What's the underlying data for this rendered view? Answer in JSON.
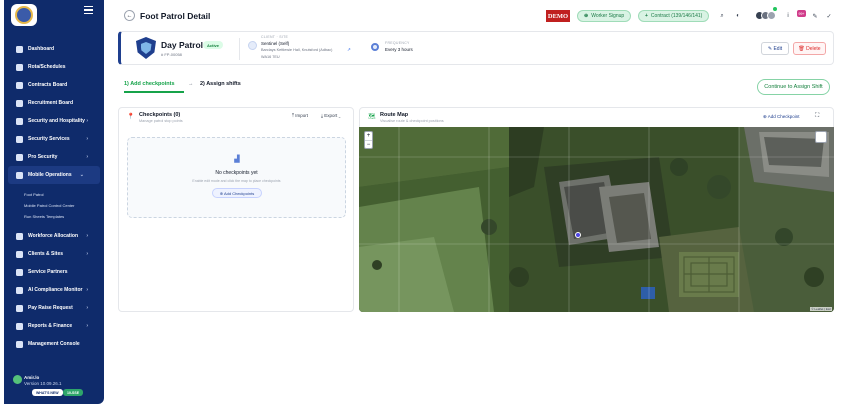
{
  "sidebar": {
    "items": [
      {
        "label": "Dashboard"
      },
      {
        "label": "Rota/Schedules"
      },
      {
        "label": "Contracts Board"
      },
      {
        "label": "Recruitment Board"
      },
      {
        "label": "Security and Hospitality",
        "chevron": "›"
      },
      {
        "label": "Security Services",
        "chevron": "›"
      },
      {
        "label": "Pro Security",
        "chevron": "›"
      },
      {
        "label": "Mobile Operations",
        "chevron": "⌄"
      }
    ],
    "sub_items": [
      {
        "label": "Foot Patrol"
      },
      {
        "label": "Mobile Patrol Control Center"
      },
      {
        "label": "Run Sheets Templates"
      }
    ],
    "items_after": [
      {
        "label": "Workforce Allocation",
        "chevron": "›"
      },
      {
        "label": "Clients & Sites",
        "chevron": "›"
      },
      {
        "label": "Service Partners"
      },
      {
        "label": "AI Compliance Monitor",
        "chevron": "›"
      },
      {
        "label": "Pay Raise Request",
        "chevron": "›"
      },
      {
        "label": "Reports & Finance",
        "chevron": "›"
      },
      {
        "label": "Management Console"
      }
    ],
    "user": {
      "name": "Amir.lo",
      "version": "Version 10.09.26.1"
    },
    "whats_new": "WHAT'S NEW",
    "env_badge": "10-SSE"
  },
  "topbar": {
    "title": "Foot Patrol Detail",
    "back_icon": "←",
    "demo_badge": "DEMO",
    "worker_signup": "Worker Signup",
    "worker_signup_icon": "⊕",
    "contract": "Contract (139/146/141)",
    "contract_icon": "+",
    "notification_count": "99+",
    "icons": {
      "search": "⌕",
      "theme": "◐",
      "info": "i",
      "edit": "✎",
      "check": "✓"
    }
  },
  "patrol": {
    "name": "Day Patrol",
    "status": "Active",
    "id": "# FP-00058",
    "client_site_label": "CLIENT · SITE",
    "client": "Sentinel (Self)",
    "site": "Barclays Kettlewie Hall, Knutsford (Adbac)",
    "postcode": "WA16 7EU",
    "external_link_icon": "↗",
    "frequency_label": "FREQUENCY",
    "frequency": "Every 3 hours",
    "edit_label": "✎  Edit",
    "delete_label": "🗑  Delete"
  },
  "steps": {
    "step1": "1) Add checkpoints",
    "arrow": "→",
    "step2": "2) Assign shifts",
    "continue": "Continue to Assign Shift"
  },
  "checkpoints": {
    "icon": "📍",
    "title": "Checkpoints (0)",
    "subtitle": "Manage patrol stop points",
    "import": "⤒  Import",
    "export": "⤓  Export  ⌄",
    "empty_icon": "▟",
    "empty_title": "No checkpoints yet",
    "empty_sub": "Enable edit mode and click the map to place checkpoints",
    "add_button": "⊕  Add Checkpoints"
  },
  "route_map": {
    "icon": "🗺",
    "title": "Route Map",
    "subtitle": "Visualise route & checkpoint positions",
    "add_button": "⊕  Add Checkpoint",
    "expand_icon": "⛶",
    "zoom_in": "+",
    "zoom_out": "−",
    "attribution": "© Leaflet | Esri"
  },
  "colors": {
    "sidebar": "#0f2b6b",
    "accent_green": "#16a34a",
    "danger": "#dc2626",
    "brand_blue": "#1f3f8e"
  }
}
